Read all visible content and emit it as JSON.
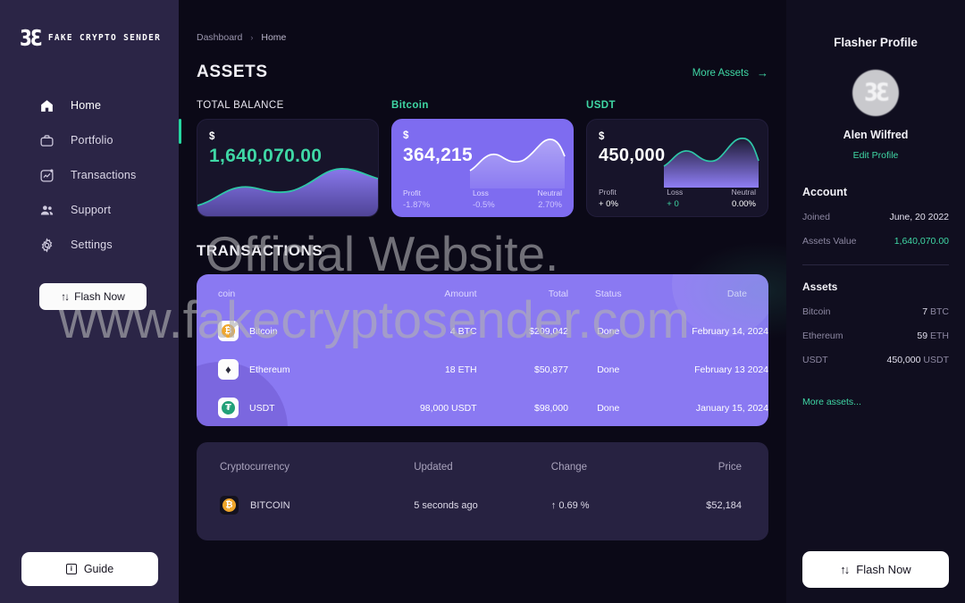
{
  "brand": {
    "mark": "3Ɛ",
    "name": "FAKE CRYPTO SENDER"
  },
  "sidebar": {
    "items": [
      {
        "label": "Home",
        "icon": "home-icon"
      },
      {
        "label": "Portfolio",
        "icon": "briefcase-icon"
      },
      {
        "label": "Transactions",
        "icon": "chart-square-icon"
      },
      {
        "label": "Support",
        "icon": "users-icon"
      },
      {
        "label": "Settings",
        "icon": "gear-icon"
      }
    ],
    "flash_button": {
      "label": "Flash Now",
      "icon": "arrows-updown-icon"
    },
    "guide_button": {
      "label": "Guide",
      "icon": "info-icon"
    },
    "active_index": 0,
    "accent": "#25d6a0"
  },
  "breadcrumb": {
    "root": "Dashboard",
    "separator": "›",
    "current": "Home"
  },
  "assets_section": {
    "title": "ASSETS",
    "more_label": "More Assets",
    "more_arrow": "→",
    "cards": [
      {
        "caption": "TOTAL BALANCE",
        "caption_color": "#e9e7f1",
        "currency": "$",
        "amount": "1,640,070.00",
        "style": "dark",
        "amount_color": "#3fd7a5",
        "stats": []
      },
      {
        "caption": "Bitcoin",
        "caption_color": "#3fd7a5",
        "currency": "$",
        "amount": "364,215",
        "style": "violet",
        "amount_color": "#ffffff",
        "stats": [
          {
            "key": "Profit",
            "value": "-1.87%"
          },
          {
            "key": "Loss",
            "value": "-0.5%"
          },
          {
            "key": "Neutral",
            "value": "2.70%"
          }
        ]
      },
      {
        "caption": "USDT",
        "caption_color": "#3fd7a5",
        "currency": "$",
        "amount": "450,000",
        "style": "dark",
        "amount_color": "#ffffff",
        "stats": [
          {
            "key": "Profit",
            "value": "+ 0%"
          },
          {
            "key": "Loss",
            "value": "+ 0"
          },
          {
            "key": "Neutral",
            "value": "0.00%"
          }
        ]
      }
    ]
  },
  "transactions": {
    "title": "TRANSACTIONS",
    "headers": [
      "coin",
      "Amount",
      "Total",
      "Status",
      "Date"
    ],
    "rows": [
      {
        "coin": "Bitcoin",
        "symbol": "₿",
        "amount": "4 BTC",
        "total": "$209,042",
        "status": "Done",
        "date": "February 14, 2024"
      },
      {
        "coin": "Ethereum",
        "symbol": "♦",
        "amount": "18  ETH",
        "total": "$50,877",
        "status": "Done",
        "date": "February 13 2024"
      },
      {
        "coin": "USDT",
        "symbol": "₮",
        "amount": "98,000 USDT",
        "total": "$98,000",
        "status": "Done",
        "date": "January 15, 2024"
      }
    ]
  },
  "crypto_table": {
    "headers": [
      "Cryptocurrency",
      "Updated",
      "Change",
      "Price"
    ],
    "rows": [
      {
        "name": "BITCOIN",
        "symbol": "₿",
        "updated": "5 seconds ago",
        "change": "↑ 0.69 %",
        "price": "$52,184"
      }
    ]
  },
  "profile": {
    "title": "Flasher Profile",
    "name": "Alen Wilfred",
    "edit_label": "Edit Profile",
    "account_section": "Account",
    "account_rows": [
      {
        "key": "Joined",
        "value": "June, 20 2022",
        "green": false
      },
      {
        "key": "Assets Value",
        "value": "1,640,070.00",
        "green": true
      }
    ],
    "assets_section": "Assets",
    "asset_rows": [
      {
        "key": "Bitcoin",
        "value": "7",
        "unit": "BTC"
      },
      {
        "key": "Ethereum",
        "value": "59",
        "unit": "ETH"
      },
      {
        "key": "USDT",
        "value": "450,000",
        "unit": "USDT"
      }
    ],
    "more_label": "More assets...",
    "flash_button": {
      "label": "Flash Now",
      "icon": "arrows-updown-icon"
    }
  },
  "watermark": {
    "line1": "Official Website.",
    "line2": "www.fakecryptosender.com"
  },
  "chart_data": [
    {
      "type": "area",
      "title": "TOTAL BALANCE sparkline",
      "x": [
        0,
        1,
        2,
        3,
        4,
        5,
        6,
        7,
        8,
        9,
        10
      ],
      "values": [
        18,
        30,
        44,
        48,
        44,
        43,
        45,
        58,
        74,
        78,
        70
      ],
      "line_color": "#2fc6a8",
      "fill_from": "#7e6cf0",
      "ylim": [
        0,
        100
      ]
    },
    {
      "type": "area",
      "title": "Bitcoin sparkline",
      "x": [
        0,
        1,
        2,
        3,
        4,
        5,
        6,
        7,
        8
      ],
      "values": [
        20,
        38,
        52,
        46,
        44,
        48,
        78,
        90,
        74
      ],
      "line_color": "#ffffff",
      "fill_from": "#ffffff",
      "ylim": [
        0,
        100
      ]
    },
    {
      "type": "area",
      "title": "USDT sparkline",
      "x": [
        0,
        1,
        2,
        3,
        4,
        5,
        6,
        7,
        8
      ],
      "values": [
        22,
        40,
        56,
        48,
        44,
        52,
        82,
        92,
        66
      ],
      "line_color": "#2fc6a8",
      "fill_from": "#7e6cf0",
      "ylim": [
        0,
        100
      ]
    }
  ]
}
